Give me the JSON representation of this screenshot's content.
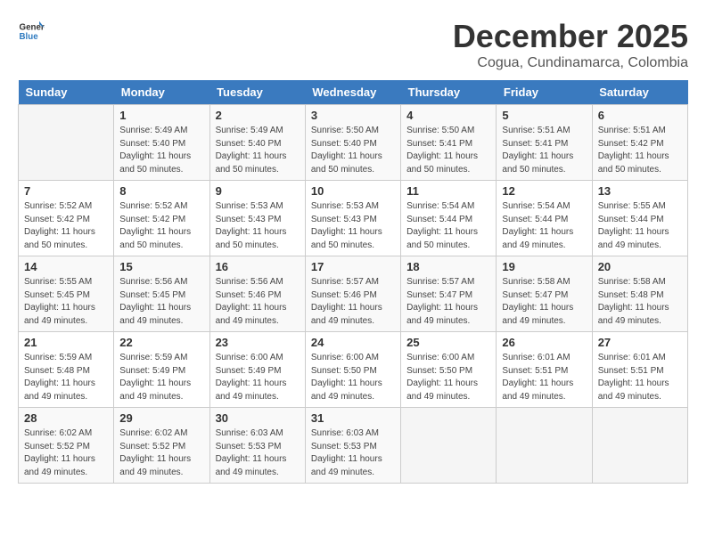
{
  "logo": {
    "general": "General",
    "blue": "Blue"
  },
  "title": "December 2025",
  "subtitle": "Cogua, Cundinamarca, Colombia",
  "weekdays": [
    "Sunday",
    "Monday",
    "Tuesday",
    "Wednesday",
    "Thursday",
    "Friday",
    "Saturday"
  ],
  "weeks": [
    [
      {
        "day": "",
        "info": ""
      },
      {
        "day": "1",
        "info": "Sunrise: 5:49 AM\nSunset: 5:40 PM\nDaylight: 11 hours\nand 50 minutes."
      },
      {
        "day": "2",
        "info": "Sunrise: 5:49 AM\nSunset: 5:40 PM\nDaylight: 11 hours\nand 50 minutes."
      },
      {
        "day": "3",
        "info": "Sunrise: 5:50 AM\nSunset: 5:40 PM\nDaylight: 11 hours\nand 50 minutes."
      },
      {
        "day": "4",
        "info": "Sunrise: 5:50 AM\nSunset: 5:41 PM\nDaylight: 11 hours\nand 50 minutes."
      },
      {
        "day": "5",
        "info": "Sunrise: 5:51 AM\nSunset: 5:41 PM\nDaylight: 11 hours\nand 50 minutes."
      },
      {
        "day": "6",
        "info": "Sunrise: 5:51 AM\nSunset: 5:42 PM\nDaylight: 11 hours\nand 50 minutes."
      }
    ],
    [
      {
        "day": "7",
        "info": "Sunrise: 5:52 AM\nSunset: 5:42 PM\nDaylight: 11 hours\nand 50 minutes."
      },
      {
        "day": "8",
        "info": "Sunrise: 5:52 AM\nSunset: 5:42 PM\nDaylight: 11 hours\nand 50 minutes."
      },
      {
        "day": "9",
        "info": "Sunrise: 5:53 AM\nSunset: 5:43 PM\nDaylight: 11 hours\nand 50 minutes."
      },
      {
        "day": "10",
        "info": "Sunrise: 5:53 AM\nSunset: 5:43 PM\nDaylight: 11 hours\nand 50 minutes."
      },
      {
        "day": "11",
        "info": "Sunrise: 5:54 AM\nSunset: 5:44 PM\nDaylight: 11 hours\nand 50 minutes."
      },
      {
        "day": "12",
        "info": "Sunrise: 5:54 AM\nSunset: 5:44 PM\nDaylight: 11 hours\nand 49 minutes."
      },
      {
        "day": "13",
        "info": "Sunrise: 5:55 AM\nSunset: 5:44 PM\nDaylight: 11 hours\nand 49 minutes."
      }
    ],
    [
      {
        "day": "14",
        "info": "Sunrise: 5:55 AM\nSunset: 5:45 PM\nDaylight: 11 hours\nand 49 minutes."
      },
      {
        "day": "15",
        "info": "Sunrise: 5:56 AM\nSunset: 5:45 PM\nDaylight: 11 hours\nand 49 minutes."
      },
      {
        "day": "16",
        "info": "Sunrise: 5:56 AM\nSunset: 5:46 PM\nDaylight: 11 hours\nand 49 minutes."
      },
      {
        "day": "17",
        "info": "Sunrise: 5:57 AM\nSunset: 5:46 PM\nDaylight: 11 hours\nand 49 minutes."
      },
      {
        "day": "18",
        "info": "Sunrise: 5:57 AM\nSunset: 5:47 PM\nDaylight: 11 hours\nand 49 minutes."
      },
      {
        "day": "19",
        "info": "Sunrise: 5:58 AM\nSunset: 5:47 PM\nDaylight: 11 hours\nand 49 minutes."
      },
      {
        "day": "20",
        "info": "Sunrise: 5:58 AM\nSunset: 5:48 PM\nDaylight: 11 hours\nand 49 minutes."
      }
    ],
    [
      {
        "day": "21",
        "info": "Sunrise: 5:59 AM\nSunset: 5:48 PM\nDaylight: 11 hours\nand 49 minutes."
      },
      {
        "day": "22",
        "info": "Sunrise: 5:59 AM\nSunset: 5:49 PM\nDaylight: 11 hours\nand 49 minutes."
      },
      {
        "day": "23",
        "info": "Sunrise: 6:00 AM\nSunset: 5:49 PM\nDaylight: 11 hours\nand 49 minutes."
      },
      {
        "day": "24",
        "info": "Sunrise: 6:00 AM\nSunset: 5:50 PM\nDaylight: 11 hours\nand 49 minutes."
      },
      {
        "day": "25",
        "info": "Sunrise: 6:00 AM\nSunset: 5:50 PM\nDaylight: 11 hours\nand 49 minutes."
      },
      {
        "day": "26",
        "info": "Sunrise: 6:01 AM\nSunset: 5:51 PM\nDaylight: 11 hours\nand 49 minutes."
      },
      {
        "day": "27",
        "info": "Sunrise: 6:01 AM\nSunset: 5:51 PM\nDaylight: 11 hours\nand 49 minutes."
      }
    ],
    [
      {
        "day": "28",
        "info": "Sunrise: 6:02 AM\nSunset: 5:52 PM\nDaylight: 11 hours\nand 49 minutes."
      },
      {
        "day": "29",
        "info": "Sunrise: 6:02 AM\nSunset: 5:52 PM\nDaylight: 11 hours\nand 49 minutes."
      },
      {
        "day": "30",
        "info": "Sunrise: 6:03 AM\nSunset: 5:53 PM\nDaylight: 11 hours\nand 49 minutes."
      },
      {
        "day": "31",
        "info": "Sunrise: 6:03 AM\nSunset: 5:53 PM\nDaylight: 11 hours\nand 49 minutes."
      },
      {
        "day": "",
        "info": ""
      },
      {
        "day": "",
        "info": ""
      },
      {
        "day": "",
        "info": ""
      }
    ]
  ]
}
